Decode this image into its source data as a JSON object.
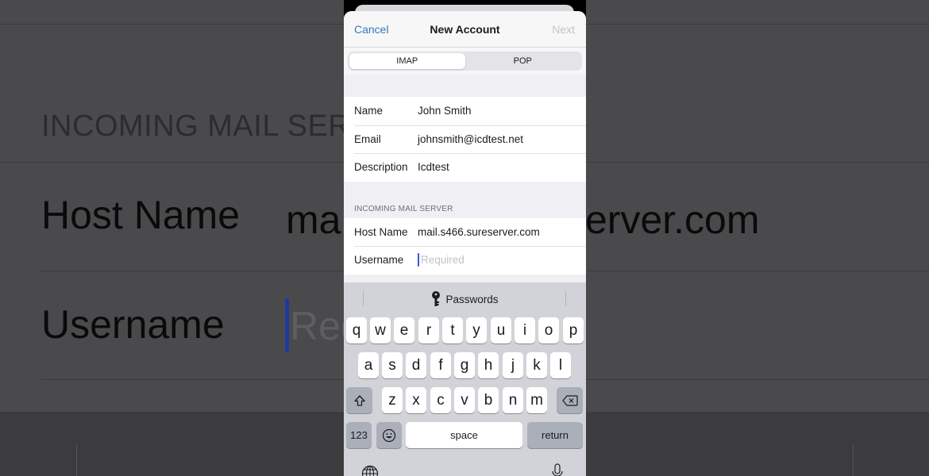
{
  "background": {
    "section_header": "INCOMING MAIL SER",
    "host_label": "Host Name",
    "host_value_left": "ma",
    "host_value_right": "erver.com",
    "username_label": "Username",
    "username_placeholder_partial": "Req"
  },
  "navbar": {
    "cancel_label": "Cancel",
    "title": "New Account",
    "next_label": "Next"
  },
  "segmented": {
    "options": [
      "IMAP",
      "POP"
    ],
    "selected": "IMAP"
  },
  "account_fields": [
    {
      "label": "Name",
      "value": "John Smith"
    },
    {
      "label": "Email",
      "value": "johnsmith@icdtest.net"
    },
    {
      "label": "Description",
      "value": "Icdtest"
    }
  ],
  "incoming_server": {
    "header": "INCOMING MAIL SERVER",
    "host_name_label": "Host Name",
    "host_name_value": "mail.s466.sureserver.com",
    "username_label": "Username",
    "username_placeholder": "Required"
  },
  "keyboard": {
    "suggestion": "Passwords",
    "row1": [
      "q",
      "w",
      "e",
      "r",
      "t",
      "y",
      "u",
      "i",
      "o",
      "p"
    ],
    "row2": [
      "a",
      "s",
      "d",
      "f",
      "g",
      "h",
      "j",
      "k",
      "l"
    ],
    "row3": [
      "z",
      "x",
      "c",
      "v",
      "b",
      "n",
      "m"
    ],
    "numbers_label": "123",
    "space_label": "space",
    "return_label": "return"
  },
  "colors": {
    "accent": "#3478c6",
    "disabled": "#c4c4c8",
    "caret": "#3c56c8"
  }
}
